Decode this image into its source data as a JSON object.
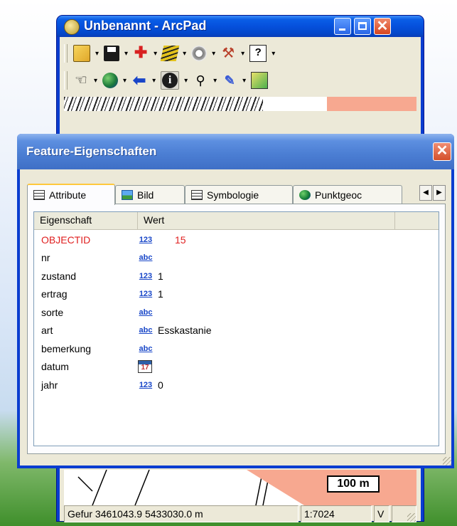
{
  "arcpad": {
    "title": "Unbenannt - ArcPad",
    "toolbar1": [
      {
        "icon": "open-folder-icon"
      },
      {
        "icon": "save-icon"
      },
      {
        "icon": "add-point-icon"
      },
      {
        "icon": "layers-icon"
      },
      {
        "icon": "gps-icon"
      },
      {
        "icon": "tools-icon"
      },
      {
        "icon": "help-icon"
      }
    ],
    "toolbar2": [
      {
        "icon": "pan-hand-icon"
      },
      {
        "icon": "globe-icon"
      },
      {
        "icon": "back-arrow-icon"
      },
      {
        "icon": "identify-info-icon"
      },
      {
        "icon": "find-binoculars-icon"
      },
      {
        "icon": "edit-pencil-icon"
      },
      {
        "icon": "refresh-icon"
      }
    ],
    "map": {
      "scale_label": "100 m"
    },
    "status": {
      "coord_prefix": "Gefur",
      "coordinates": "3461043.9 5433030.0 m",
      "scale": "1:7024",
      "mode": "V"
    }
  },
  "dialog": {
    "title": "Feature-Eigenschaften",
    "tabs": [
      {
        "label": "Attribute",
        "icon": "attribute-table-icon",
        "active": true
      },
      {
        "label": "Bild",
        "icon": "picture-icon"
      },
      {
        "label": "Symbologie",
        "icon": "symbology-icon"
      },
      {
        "label": "Punktgeoc",
        "icon": "globe-icon"
      }
    ],
    "columns": [
      "Eigenschaft",
      "Wert"
    ],
    "rows": [
      {
        "name": "OBJECTID",
        "type": "123",
        "value": "15",
        "highlight": true
      },
      {
        "name": "nr",
        "type": "abc",
        "value": ""
      },
      {
        "name": "zustand",
        "type": "123",
        "value": "1"
      },
      {
        "name": "ertrag",
        "type": "123",
        "value": "1"
      },
      {
        "name": "sorte",
        "type": "abc",
        "value": ""
      },
      {
        "name": "art",
        "type": "abc",
        "value": "Esskastanie"
      },
      {
        "name": "bemerkung",
        "type": "abc",
        "value": ""
      },
      {
        "name": "datum",
        "type": "date",
        "value": ""
      },
      {
        "name": "jahr",
        "type": "123",
        "value": "0"
      }
    ]
  },
  "colors": {
    "xp_blue": "#0a3dd0",
    "dialog_title": "#4c7fd4",
    "highlight_red": "#e02020",
    "type_icon_blue": "#1846c8",
    "map_salmon": "#f7a890"
  }
}
